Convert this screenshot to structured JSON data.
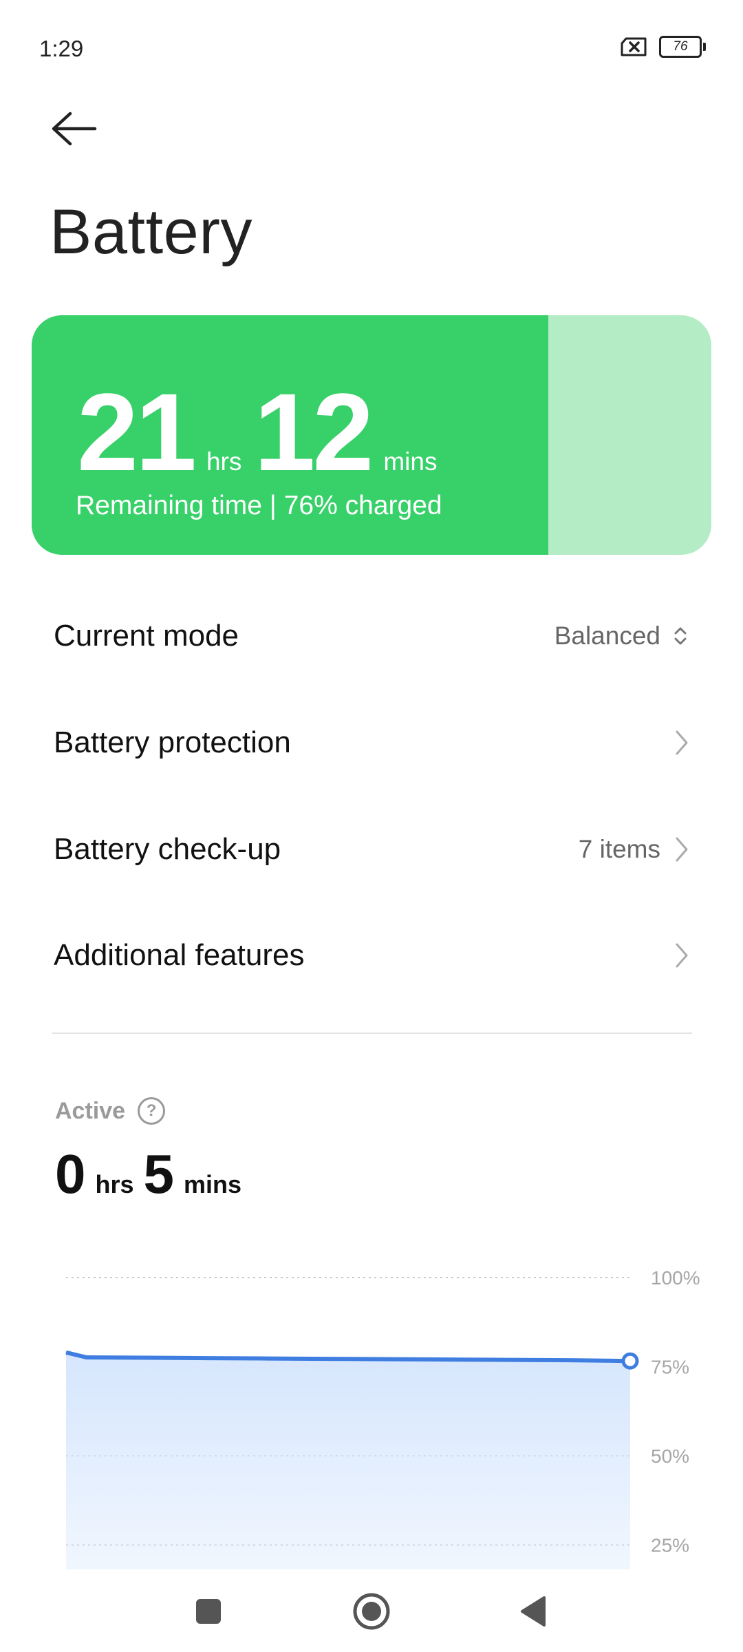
{
  "status_bar": {
    "time": "1:29",
    "battery_level": "76"
  },
  "header": {
    "title": "Battery"
  },
  "battery_card": {
    "hours": "21",
    "hours_unit": "hrs",
    "minutes": "12",
    "minutes_unit": "mins",
    "remaining_text": "Remaining time | 76% charged",
    "charge_fraction": 0.76,
    "fill_color": "#38d069",
    "track_color": "#b4ecc6"
  },
  "settings": {
    "current_mode": {
      "label": "Current mode",
      "value": "Balanced"
    },
    "battery_protection": {
      "label": "Battery protection"
    },
    "battery_checkup": {
      "label": "Battery check-up",
      "value": "7 items"
    },
    "additional_features": {
      "label": "Additional features"
    }
  },
  "active": {
    "label": "Active",
    "hours": "0",
    "hours_unit": "hrs",
    "minutes": "5",
    "minutes_unit": "mins"
  },
  "chart_data": {
    "type": "area",
    "y_ticks": [
      "100%",
      "75%",
      "50%",
      "25%"
    ],
    "ylim": [
      0,
      100
    ],
    "series": [
      {
        "values": [
          79,
          77.6,
          77.5,
          77.4,
          77.3,
          77.2,
          77.1,
          77,
          76.9,
          76.8,
          76.6
        ]
      }
    ],
    "line_color": "#3f7ee0",
    "fill_color": "#d6e6fd"
  },
  "nav": {
    "recents": "recents",
    "home": "home",
    "back": "back"
  }
}
